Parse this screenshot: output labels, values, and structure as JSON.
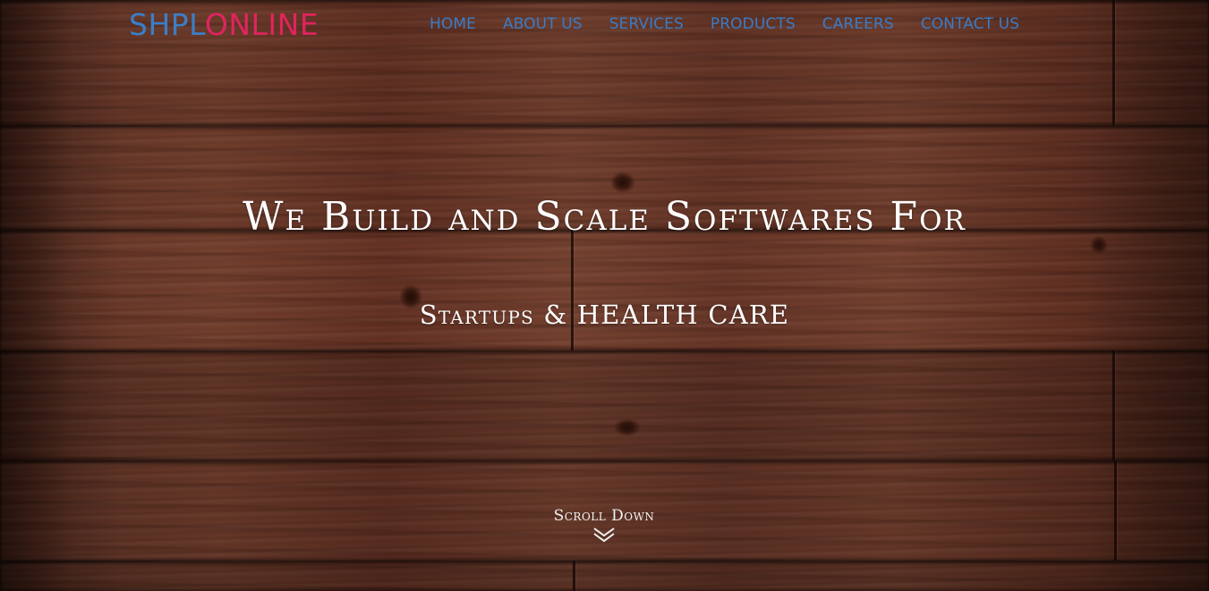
{
  "brand": {
    "logo_part1": "SHPL",
    "logo_part2": "ONLINE",
    "logo_color1": "#3b7ec7",
    "logo_color2": "#e0245e"
  },
  "nav": {
    "items": [
      {
        "label": "HOME"
      },
      {
        "label": "ABOUT US"
      },
      {
        "label": "SERVICES"
      },
      {
        "label": "PRODUCTS"
      },
      {
        "label": "CAREERS"
      },
      {
        "label": "CONTACT US"
      }
    ],
    "color": "#3a7bc6"
  },
  "hero": {
    "headline": "We Build and Scale Softwares For",
    "subheadline": "Startups & HEALTH CARE",
    "background": "wood-planks",
    "text_color": "#ffffff"
  },
  "scroll": {
    "label": "Scroll Down",
    "icon": "double-chevron-down-icon"
  }
}
